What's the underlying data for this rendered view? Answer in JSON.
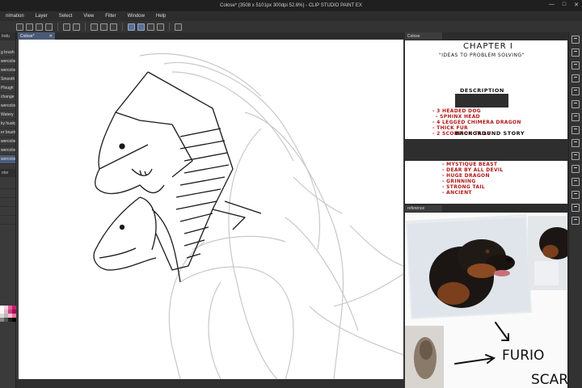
{
  "window": {
    "title": "Colose* (3508 x 5101px 300dpi 52.6%) - CLIP STUDIO PAINT EX",
    "minimize": "—",
    "maximize": "□",
    "close": "✕"
  },
  "menu": [
    "nimation",
    "Layer",
    "Select",
    "View",
    "Filter",
    "Window",
    "Help"
  ],
  "toolbar_icons": [
    "new-icon",
    "open-icon",
    "save-icon",
    "export-icon",
    "undo-icon",
    "redo-icon",
    "clear-icon",
    "transform-icon",
    "snap-icon",
    "ruler-icon",
    "ruler-snap-icon",
    "perspective-icon",
    "grid-icon",
    "eyedropper-icon"
  ],
  "left_panel": {
    "header": "Indu",
    "brushes": [
      "g brush",
      "wercolor",
      "wercolor",
      "Smooth",
      "Plough",
      "change",
      "wercolor",
      "Watery",
      "ky husky",
      "er brush",
      "wercolor",
      "wercolor",
      "wercolor"
    ],
    "selected_index": 12,
    "color_header": "olor",
    "swatch_colors": [
      "#ffffff",
      "#f0d0d8",
      "#e060a0",
      "#c02070",
      "#f8f8f8",
      "#e8b0c0",
      "#d04080",
      "#a01050",
      "#d8d8d8",
      "#b8b8b8",
      "#ffc0d0",
      "#ff70a0",
      "#888888",
      "#555555",
      "#202020",
      "#000000"
    ]
  },
  "document_tab": {
    "label": "Colose*",
    "close": "✕"
  },
  "reference_tabs": [
    {
      "label": "Colose"
    },
    {
      "label": "reference"
    }
  ],
  "reference_doc": {
    "chapter": "CHAPTER I",
    "subtitle": "\"IDEAS TO PROBLEM SOLVING\"",
    "description_heading": "DESCRIPTION",
    "description_items": [
      "- 3 HEADED DOG",
      "- SPHINX HEAD",
      "- 4 LEGGED CHIMERA DRAGON",
      "- THICK FUR",
      "- 2 SCORPION TAILS"
    ],
    "background_heading": "BACKGROUND STORY",
    "background_items": [
      "- MYSTIQUE BEAST",
      "- DEAR BY ALL DEVIL",
      "- HUGE DRAGON",
      "- GRINNING",
      "- STRONG TAIL",
      "- ANCIENT"
    ]
  },
  "reference_board": {
    "label_1": "FURIO",
    "label_2": "SCAR"
  }
}
